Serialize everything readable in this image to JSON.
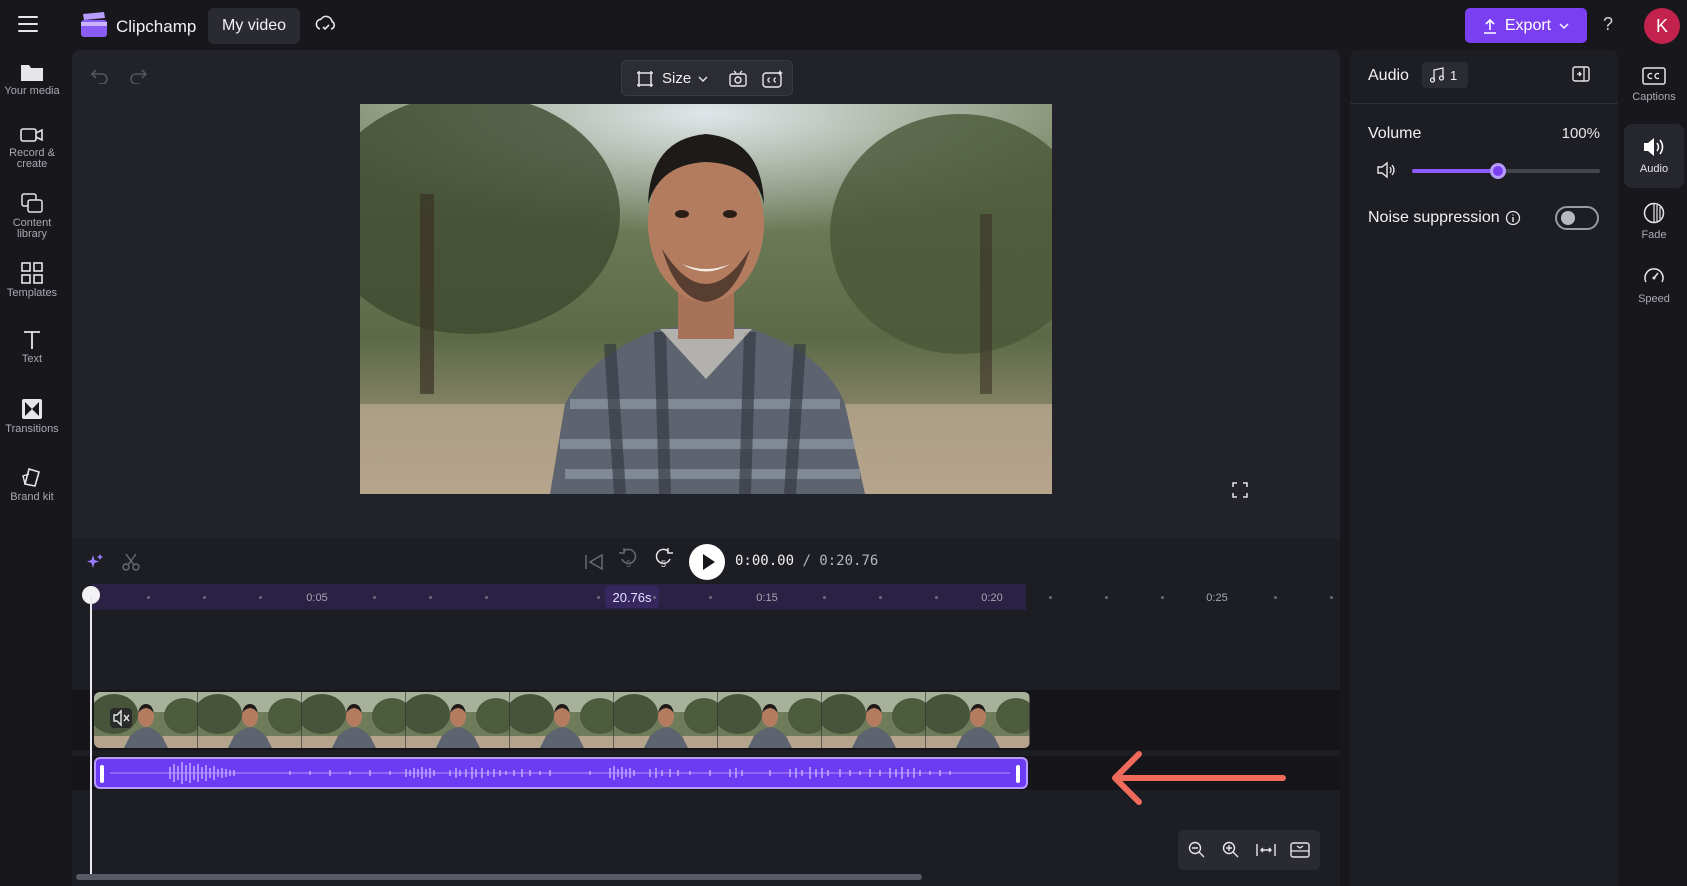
{
  "app": {
    "name": "Clipchamp",
    "project_title": "My video"
  },
  "header": {
    "export_label": "Export",
    "help_label": "?",
    "avatar_initial": "K"
  },
  "left_rail": [
    {
      "icon": "folder-icon",
      "label_lines": [
        "Your media"
      ]
    },
    {
      "icon": "camera-icon",
      "label_lines": [
        "Record &",
        "create"
      ]
    },
    {
      "icon": "content-library-icon",
      "label_lines": [
        "Content",
        "library"
      ]
    },
    {
      "icon": "templates-icon",
      "label_lines": [
        "Templates"
      ]
    },
    {
      "icon": "text-icon",
      "label_lines": [
        "Text"
      ]
    },
    {
      "icon": "transitions-icon",
      "label_lines": [
        "Transitions"
      ]
    },
    {
      "icon": "brand-kit-icon",
      "label_lines": [
        "Brand kit"
      ]
    }
  ],
  "stage_toolbar": {
    "size_label": "Size"
  },
  "playback": {
    "current": "0:00.00",
    "total": "/ 0:20.76",
    "skip_back_label": "5",
    "skip_forward_label": "5"
  },
  "ruler": {
    "labels": [
      "0:05",
      "0:15",
      "0:20",
      "0:25"
    ],
    "duration_badge": "20.76s"
  },
  "properties": {
    "title": "Audio",
    "track_count": "1",
    "volume_label": "Volume",
    "volume_value": "100%",
    "volume_level": 0.46,
    "noise_label": "Noise suppression",
    "noise_enabled": false
  },
  "right_rail": [
    {
      "icon": "captions-icon",
      "label": "Captions",
      "active": false
    },
    {
      "icon": "audio-icon",
      "label": "Audio",
      "active": true
    },
    {
      "icon": "fade-icon",
      "label": "Fade",
      "active": false
    },
    {
      "icon": "speed-icon",
      "label": "Speed",
      "active": false
    }
  ],
  "colors": {
    "accent": "#7b3ff2",
    "audio_clip": "#6d3bf1",
    "annotation_arrow": "#f06b5c",
    "avatar": "#c2224d"
  }
}
